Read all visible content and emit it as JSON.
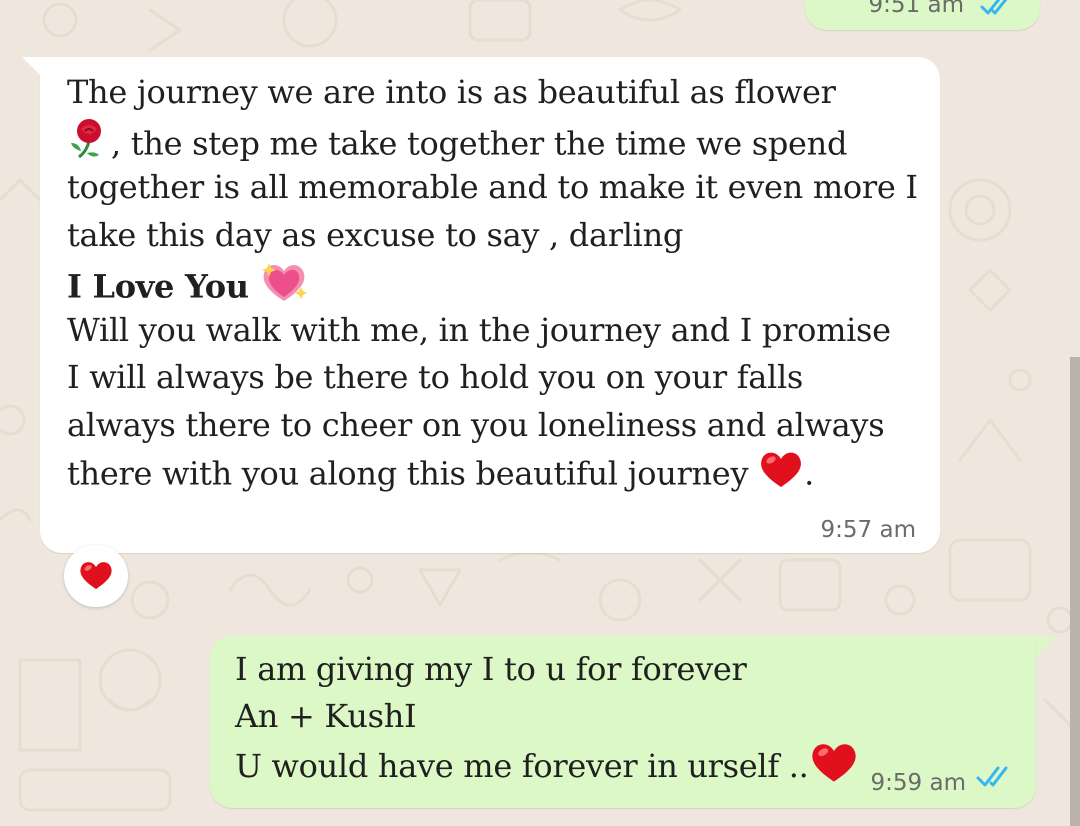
{
  "colors": {
    "wallpaper": "#efe7de",
    "incoming_bubble": "#ffffff",
    "outgoing_bubble": "#dcf8c6",
    "read_ticks": "#34b7f1",
    "time_text": "#6b6b6b"
  },
  "messages": {
    "top_partial": {
      "time": "9:51 am",
      "status_icon": "double-check-read-icon"
    },
    "incoming": {
      "line1": "The journey we are into is as beautiful as flower",
      "line2": ", the step me take together the time we spend",
      "line3": "together is all memorable and to make it even more I",
      "line4": "take this day as excuse to say , darling",
      "line5_bold": "I Love You",
      "line6": "Will you walk with me, in the journey and I promise",
      "line7": "I will always be there to hold you on your falls",
      "line8": "always there to cheer on you loneliness and always",
      "line9": "there with you along this beautiful journey",
      "line9_end": ".",
      "time": "9:57 am",
      "emojis": [
        "rose-emoji",
        "sparkling-heart-emoji",
        "red-heart-emoji"
      ],
      "reaction": "red-heart-emoji"
    },
    "outgoing": {
      "line1": "I am giving my I to u for forever",
      "line2": "An + KushI",
      "line3": "U would have me forever in urself ..",
      "time": "9:59 am",
      "status_icon": "double-check-read-icon",
      "emojis": [
        "red-heart-emoji"
      ]
    }
  }
}
